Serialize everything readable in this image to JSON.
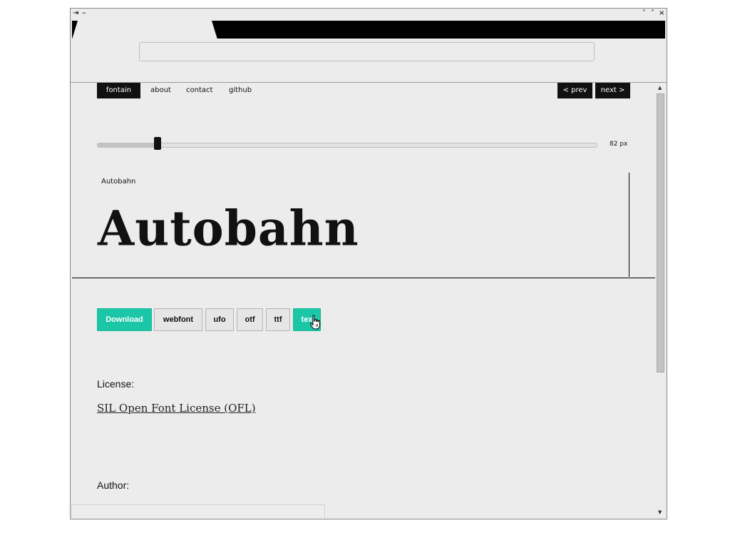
{
  "window": {
    "pin_icon": "⇥",
    "minimize_icon": "–",
    "controls": {
      "collapse": "˅",
      "expand": "˄",
      "close": "×"
    }
  },
  "nav": {
    "items": [
      "fontain",
      "about",
      "contact",
      "github"
    ],
    "active_index": 0,
    "prev_label": "< prev",
    "next_label": "next >"
  },
  "size_slider": {
    "value_fraction": 0.12,
    "label": "82 px"
  },
  "preview": {
    "font_name": "Autobahn",
    "sample_text": "Autobahn"
  },
  "downloads": {
    "download_label": "Download",
    "formats": [
      "webfont",
      "ufo",
      "otf",
      "ttf",
      "tex"
    ]
  },
  "license": {
    "label": "License:",
    "link_text": "SIL Open Font License (OFL)"
  },
  "author": {
    "label": "Author:"
  },
  "colors": {
    "accent": "#1bc7a7",
    "dark": "#111111",
    "background": "#ececec"
  },
  "icons": {
    "cursor": "hand-pointer-icon",
    "scroll_up": "triangle-up-icon",
    "scroll_down": "triangle-down-icon"
  }
}
